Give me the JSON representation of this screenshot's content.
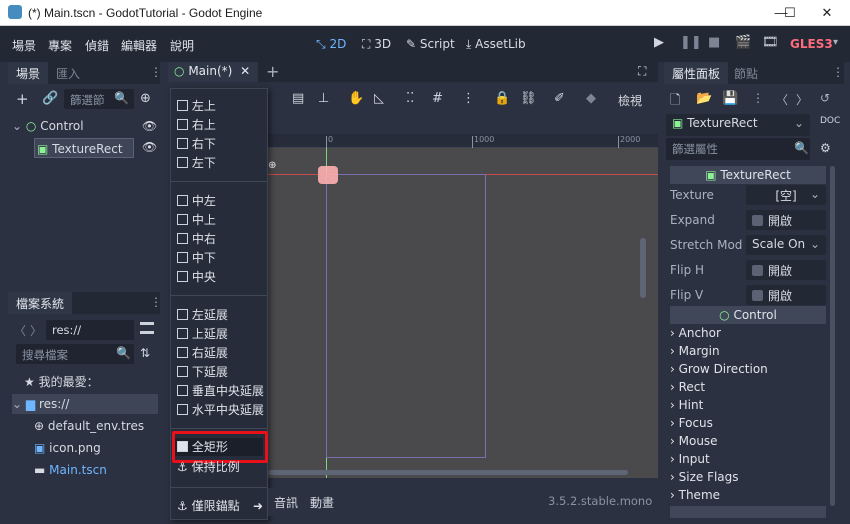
{
  "window": {
    "title": "(*) Main.tscn - GodotTutorial - Godot Engine",
    "minimize": "—",
    "maximize": "☐",
    "close": "✕"
  },
  "menu": {
    "items": [
      "場景",
      "專案",
      "偵錯",
      "編輯器",
      "說明"
    ]
  },
  "workspaces": {
    "d2": "2D",
    "d3": "3D",
    "script": "Script",
    "assetlib": "AssetLib"
  },
  "renderer": "GLES3",
  "scene_dock": {
    "tab_scene": "場景",
    "tab_import": "匯入",
    "filter_placeholder": "篩選節",
    "nodes": [
      {
        "label": "Control"
      },
      {
        "label": "TextureRect"
      }
    ]
  },
  "filesystem": {
    "title": "檔案系統",
    "path": "res://",
    "search_placeholder": "搜尋檔案",
    "favorites": "我的最愛：",
    "root": "res://",
    "files": [
      "default_env.tres",
      "icon.png",
      "Main.tscn"
    ]
  },
  "editor_tab": {
    "label": "Main(*)"
  },
  "toolbar": {
    "view_label": "檢視"
  },
  "ruler": {
    "zero": "0",
    "t1000": "1000",
    "t2000": "2000"
  },
  "dropdown": {
    "anchors": [
      "左上",
      "右上",
      "右下",
      "左下"
    ],
    "centers": [
      "中左",
      "中上",
      "中右",
      "中下",
      "中央"
    ],
    "wides": [
      "左延展",
      "上延展",
      "右延展",
      "下延展",
      "垂直中央延展",
      "水平中央延展"
    ],
    "full_rect": "全矩形",
    "keep_ratio": "保持比例",
    "anchors_only": "僅限錨點"
  },
  "bottom_bar": {
    "audio": "音訊",
    "animation": "動畫",
    "version": "3.5.2.stable.mono"
  },
  "inspector": {
    "tab_inspector": "屬性面板",
    "tab_node": "節點",
    "object": "TextureRect",
    "filter_placeholder": "篩選屬性",
    "class_header": "TextureRect",
    "props": [
      {
        "name": "Texture",
        "value": "[空]"
      },
      {
        "name": "Expand",
        "value": "開啟"
      },
      {
        "name": "Stretch Mod",
        "value": "Scale On"
      },
      {
        "name": "Flip H",
        "value": "開啟"
      },
      {
        "name": "Flip V",
        "value": "開啟"
      }
    ],
    "control_header": "Control",
    "sections": [
      "Anchor",
      "Margin",
      "Grow Direction",
      "Rect",
      "Hint",
      "Focus",
      "Mouse",
      "Input",
      "Size Flags",
      "Theme"
    ]
  },
  "colors": {
    "accent": "#6fb5ff",
    "highlight_box": "#e8101a",
    "viewport": "#4a4a4c"
  }
}
